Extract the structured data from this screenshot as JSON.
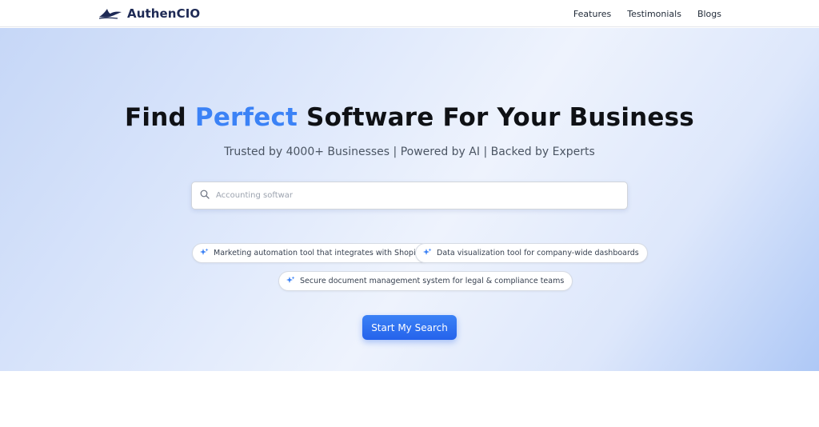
{
  "brand": {
    "name": "AuthenCIO",
    "logo_icon": "bird-logo-icon",
    "color": "#1e2a55"
  },
  "nav": {
    "links": [
      {
        "label": "Features"
      },
      {
        "label": "Testimonials"
      },
      {
        "label": "Blogs"
      }
    ]
  },
  "hero": {
    "title_pre": "Find",
    "title_accent": "Perfect",
    "title_post": "Software For Your Business",
    "accent_color": "#3b82f6",
    "subtitle": "Trusted by 4000+ Businesses | Powered by AI | Backed by Experts"
  },
  "search": {
    "icon": "search-icon",
    "value": "",
    "placeholder": "Accounting softwar"
  },
  "suggestions": [
    {
      "icon": "sparkle-icon",
      "label": "Marketing automation tool that integrates with Shopify"
    },
    {
      "icon": "sparkle-icon",
      "label": "Data visualization tool for company-wide dashboards"
    },
    {
      "icon": "sparkle-icon",
      "label": "Secure document management system for legal & compliance teams"
    }
  ],
  "cta": {
    "label": "Start My Search",
    "color": "#2563eb"
  }
}
